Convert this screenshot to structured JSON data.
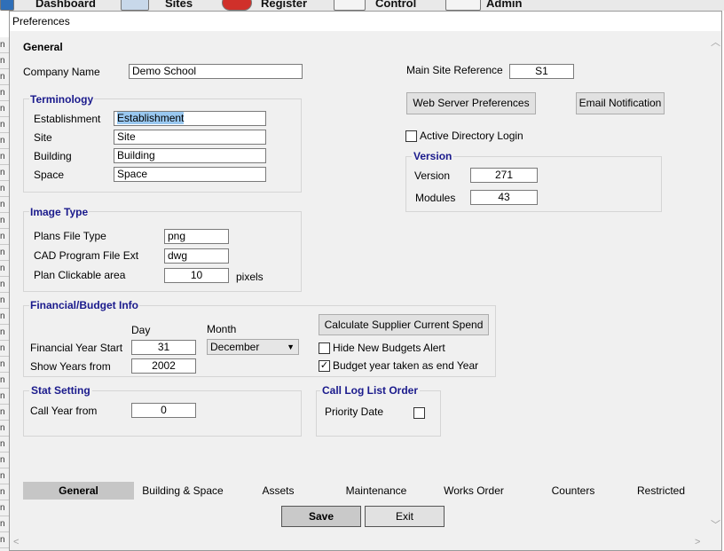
{
  "background_app": {
    "toolbar": [
      "Dashboard",
      "Sites",
      "Register",
      "Control",
      "Admin"
    ]
  },
  "dialog": {
    "title": "Preferences",
    "heading": "General",
    "company_name": {
      "label": "Company Name",
      "value": "Demo School"
    },
    "main_site_reference": {
      "label": "Main Site Reference",
      "value": "S1"
    },
    "terminology": {
      "title": "Terminology",
      "fields": [
        {
          "label": "Establishment",
          "value": "Establishment"
        },
        {
          "label": "Site",
          "value": "Site"
        },
        {
          "label": "Building",
          "value": "Building"
        },
        {
          "label": "Space",
          "value": "Space"
        }
      ]
    },
    "web_server_button": "Web Server Preferences",
    "email_notification_button": "Email Notification",
    "active_directory": {
      "label": "Active  Directory Login",
      "checked": false
    },
    "version_group": {
      "title": "Version",
      "version": {
        "label": "Version",
        "value": "271"
      },
      "modules": {
        "label": "Modules",
        "value": "43"
      }
    },
    "image_type": {
      "title": "Image Type",
      "plans_file_type": {
        "label": "Plans File Type",
        "value": "png"
      },
      "cad_ext": {
        "label": "CAD Program File Ext",
        "value": "dwg"
      },
      "clickable": {
        "label": "Plan Clickable area",
        "value": "10",
        "unit": "pixels"
      }
    },
    "financial": {
      "title": "Financial/Budget Info",
      "day_header": "Day",
      "month_header": "Month",
      "year_start": {
        "label": "Financial Year Start",
        "day": "31",
        "month": "December"
      },
      "show_years": {
        "label": "Show Years from",
        "value": "2002"
      },
      "calc_button": "Calculate Supplier Current Spend",
      "hide_alert": {
        "label": "Hide New Budgets Alert",
        "checked": false
      },
      "budget_end": {
        "label": "Budget year taken as end Year",
        "checked": true
      }
    },
    "stat_setting": {
      "title": "Stat Setting",
      "call_year": {
        "label": "Call Year from",
        "value": "0"
      }
    },
    "call_log": {
      "title": "Call Log List Order",
      "priority_date": {
        "label": "Priority Date",
        "checked": false
      }
    },
    "tabs": [
      {
        "label": "General",
        "active": true
      },
      {
        "label": "Building & Space",
        "active": false
      },
      {
        "label": "Assets",
        "active": false
      },
      {
        "label": "Maintenance",
        "active": false
      },
      {
        "label": "Works Order",
        "active": false
      },
      {
        "label": "Counters",
        "active": false
      },
      {
        "label": "Restricted",
        "active": false
      }
    ],
    "save_button": "Save",
    "exit_button": "Exit"
  }
}
